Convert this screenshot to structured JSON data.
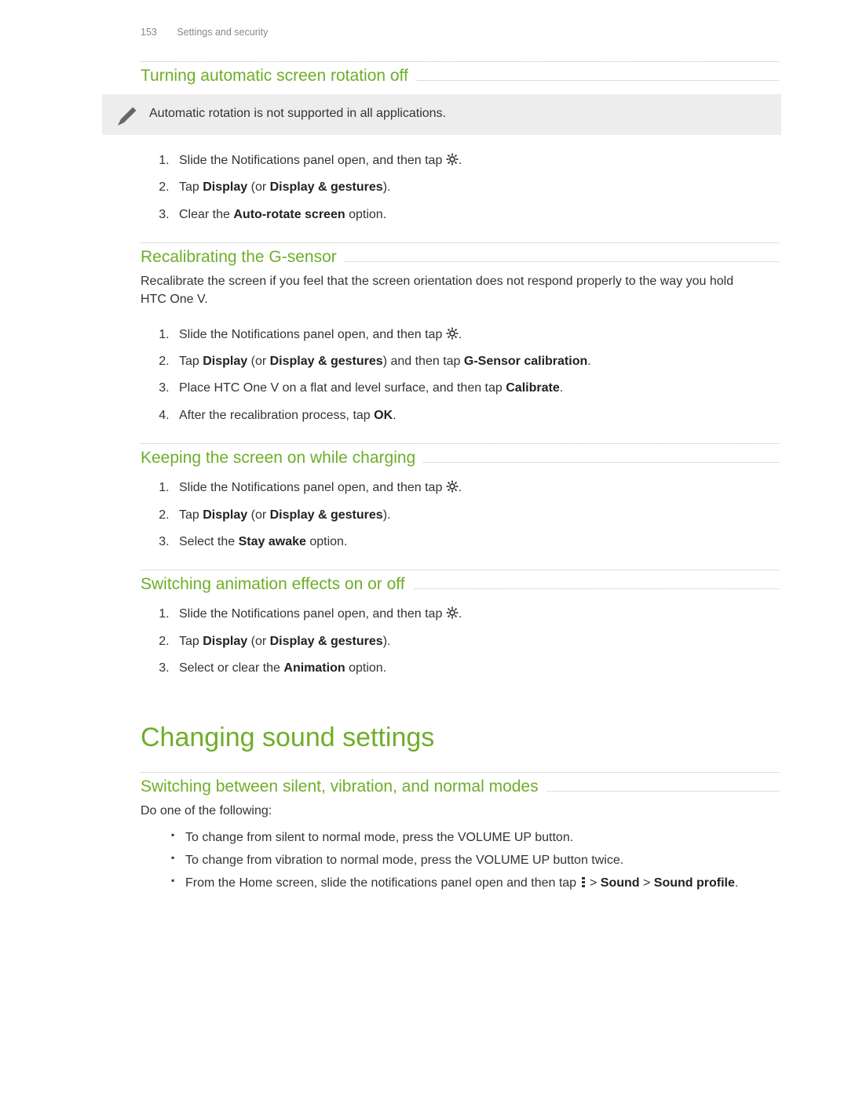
{
  "header": {
    "page_number": "153",
    "section_name": "Settings and security"
  },
  "sections": [
    {
      "title": "Turning automatic screen rotation off",
      "callout": "Automatic rotation is not supported in all applications.",
      "steps": [
        {
          "prefix": "Slide the Notifications panel open, and then tap ",
          "icon": "settings",
          "suffix": "."
        },
        {
          "full": "Tap <b>Display</b> (or <b>Display & gestures</b>)."
        },
        {
          "full": "Clear the <b>Auto-rotate screen</b> option."
        }
      ]
    },
    {
      "title": "Recalibrating the G-sensor",
      "paragraph": "Recalibrate the screen if you feel that the screen orientation does not respond properly to the way you hold HTC One V.",
      "steps": [
        {
          "prefix": "Slide the Notifications panel open, and then tap ",
          "icon": "settings",
          "suffix": "."
        },
        {
          "full": "Tap <b>Display</b> (or <b>Display & gestures</b>) and then tap <b>G-Sensor calibration</b>."
        },
        {
          "full": "Place HTC One V on a flat and level surface, and then tap <b>Calibrate</b>."
        },
        {
          "full": "After the recalibration process, tap <b>OK</b>."
        }
      ]
    },
    {
      "title": "Keeping the screen on while charging",
      "steps": [
        {
          "prefix": "Slide the Notifications panel open, and then tap ",
          "icon": "settings",
          "suffix": "."
        },
        {
          "full": "Tap <b>Display</b> (or <b>Display & gestures</b>)."
        },
        {
          "full": "Select the <b>Stay awake</b> option."
        }
      ]
    },
    {
      "title": "Switching animation effects on or off",
      "steps": [
        {
          "prefix": "Slide the Notifications panel open, and then tap ",
          "icon": "settings",
          "suffix": "."
        },
        {
          "full": "Tap <b>Display</b> (or <b>Display & gestures</b>)."
        },
        {
          "full": "Select or clear the <b>Animation</b> option."
        }
      ]
    }
  ],
  "major_heading": "Changing sound settings",
  "sound_section": {
    "title": "Switching between silent, vibration, and normal modes",
    "intro": "Do one of the following:",
    "bullets": [
      {
        "full": "To change from silent to normal mode, press the VOLUME UP button."
      },
      {
        "full": "To change from vibration to normal mode, press the VOLUME UP button twice."
      },
      {
        "prefix": "From the Home screen, slide the notifications panel open and then tap ",
        "icon": "menu-dots",
        "suffix": " > <b>Sound</b> > <b>Sound profile</b>."
      }
    ]
  }
}
